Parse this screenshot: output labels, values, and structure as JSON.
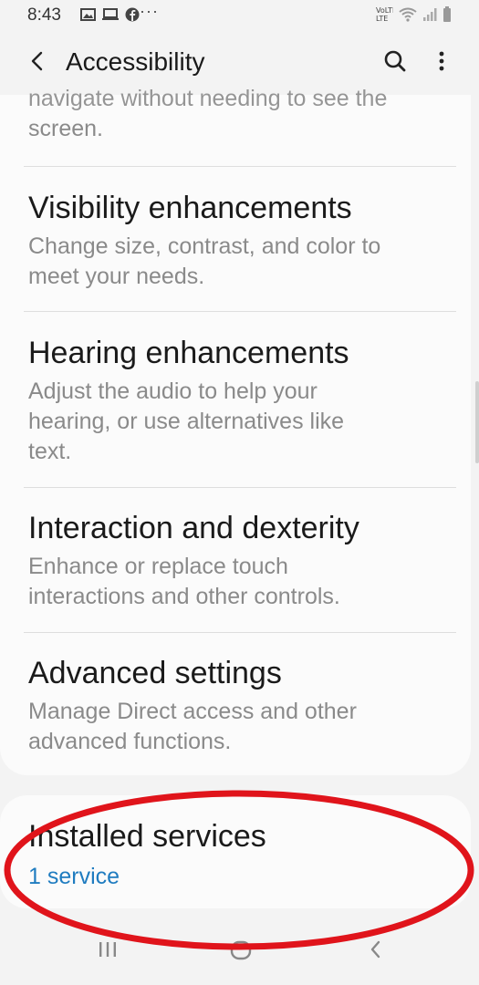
{
  "status_bar": {
    "time": "8:43",
    "overflow": "···",
    "network_label": "VoLTE"
  },
  "app_bar": {
    "title": "Accessibility"
  },
  "menu": {
    "partial_item": {
      "desc_hidden_line": "navigate without needing to see the",
      "desc_visible_line": "screen."
    },
    "items": [
      {
        "title": "Visibility enhancements",
        "description": [
          "Change size, contrast, and color to",
          "meet your needs."
        ]
      },
      {
        "title": "Hearing enhancements",
        "description": [
          "Adjust the audio to help your",
          "hearing, or use alternatives like",
          "text."
        ]
      },
      {
        "title": "Interaction and dexterity",
        "description": [
          "Enhance or replace touch",
          "interactions and other controls."
        ]
      },
      {
        "title": "Advanced settings",
        "description": [
          "Manage Direct access and other",
          "advanced functions."
        ]
      }
    ]
  },
  "installed_services": {
    "title": "Installed services",
    "count": "1 service"
  },
  "colors": {
    "link_blue": "#1f7cc0",
    "annotation_red": "#e0141b",
    "secondary_text": "#8a8a8a"
  }
}
